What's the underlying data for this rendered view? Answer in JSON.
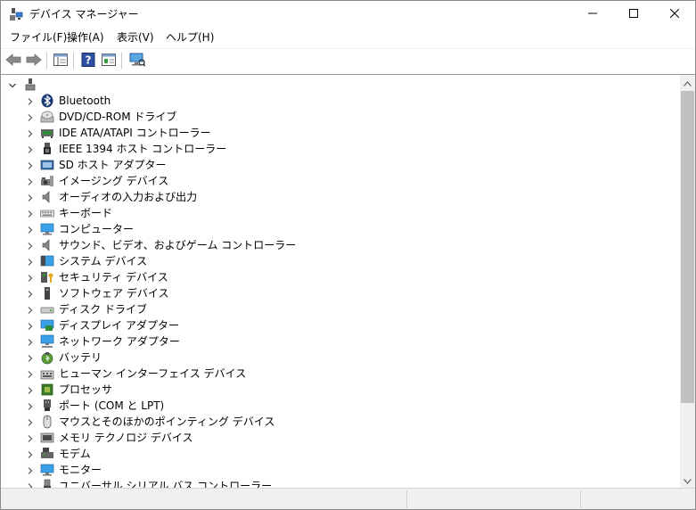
{
  "window": {
    "title": "デバイス マネージャー"
  },
  "menu": [
    "ファイル(F)",
    "操作(A)",
    "表示(V)",
    "ヘルプ(H)"
  ],
  "toolbar": {
    "buttons": [
      "back-arrow-icon",
      "forward-arrow-icon",
      "properties-icon",
      "help-icon",
      "properties-console-icon",
      "scan-hardware-icon"
    ]
  },
  "tree": {
    "root_label": "",
    "items": [
      {
        "label": "Bluetooth",
        "icon": "bluetooth-icon"
      },
      {
        "label": "DVD/CD-ROM ドライブ",
        "icon": "disc-drive-icon"
      },
      {
        "label": "IDE ATA/ATAPI コントローラー",
        "icon": "ide-controller-icon"
      },
      {
        "label": "IEEE 1394 ホスト コントローラー",
        "icon": "ieee1394-icon"
      },
      {
        "label": "SD ホスト アダプター",
        "icon": "sd-host-icon"
      },
      {
        "label": "イメージング デバイス",
        "icon": "imaging-device-icon"
      },
      {
        "label": "オーディオの入力および出力",
        "icon": "speaker-icon"
      },
      {
        "label": "キーボード",
        "icon": "keyboard-icon"
      },
      {
        "label": "コンピューター",
        "icon": "computer-icon"
      },
      {
        "label": "サウンド、ビデオ、およびゲーム コントローラー",
        "icon": "sound-icon"
      },
      {
        "label": "システム デバイス",
        "icon": "system-device-icon"
      },
      {
        "label": "セキュリティ デバイス",
        "icon": "security-device-icon"
      },
      {
        "label": "ソフトウェア デバイス",
        "icon": "software-device-icon"
      },
      {
        "label": "ディスク ドライブ",
        "icon": "disk-drive-icon"
      },
      {
        "label": "ディスプレイ アダプター",
        "icon": "display-adapter-icon"
      },
      {
        "label": "ネットワーク アダプター",
        "icon": "network-adapter-icon"
      },
      {
        "label": "バッテリ",
        "icon": "battery-icon"
      },
      {
        "label": "ヒューマン インターフェイス デバイス",
        "icon": "hid-icon"
      },
      {
        "label": "プロセッサ",
        "icon": "processor-icon"
      },
      {
        "label": "ポート (COM と LPT)",
        "icon": "port-icon"
      },
      {
        "label": "マウスとそのほかのポインティング デバイス",
        "icon": "mouse-icon"
      },
      {
        "label": "メモリ テクノロジ デバイス",
        "icon": "memory-tech-icon"
      },
      {
        "label": "モデム",
        "icon": "modem-icon"
      },
      {
        "label": "モニター",
        "icon": "monitor-icon"
      },
      {
        "label": "ユニバーサル シリアル バス コントローラー",
        "icon": "usb-icon"
      }
    ]
  },
  "colors": {
    "accent": "#1e6fd1",
    "scroll_thumb": "#c1c1c1",
    "status_bg": "#f0f0f0"
  }
}
